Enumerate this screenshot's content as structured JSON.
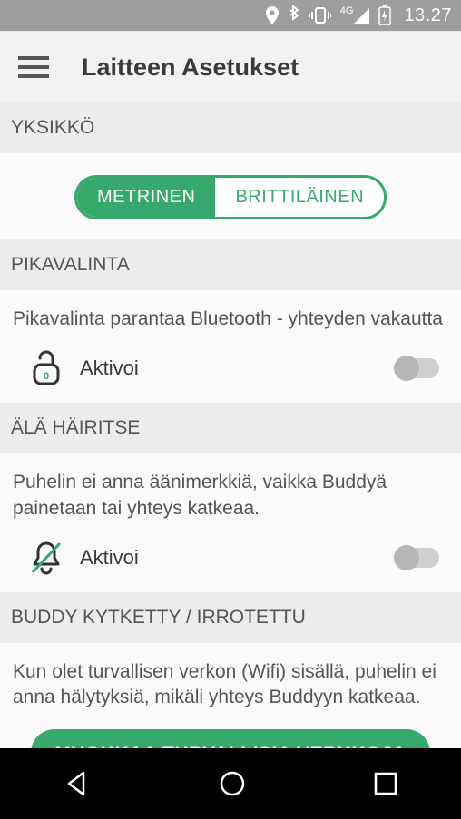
{
  "status": {
    "time": "13.27",
    "mobile_label": "4G"
  },
  "header": {
    "title": "Laitteen Asetukset"
  },
  "sections": {
    "unit": {
      "label": "YKSIKKÖ",
      "options": {
        "metric": "METRINEN",
        "imperial": "BRITTILÄINEN"
      }
    },
    "quick": {
      "label": "PIKAVALINTA",
      "desc": "Pikavalinta parantaa Bluetooth - yhteyden vakautta",
      "toggle_label": "Aktivoi"
    },
    "dnd": {
      "label": "ÄLÄ HÄIRITSE",
      "desc": "Puhelin ei anna äänimerkkiä, vaikka Buddyä painetaan tai yhteys katkeaa.",
      "toggle_label": "Aktivoi"
    },
    "buddy": {
      "label": "BUDDY KYTKETTY / IRROTETTU",
      "desc": "Kun olet turvallisen verkon (Wifi) sisällä, puhelin ei anna hälytyksiä, mikäli yhteys Buddyyn katkeaa.",
      "button": "MUOKKAA TURVALLISIA VERKKOJA"
    }
  }
}
